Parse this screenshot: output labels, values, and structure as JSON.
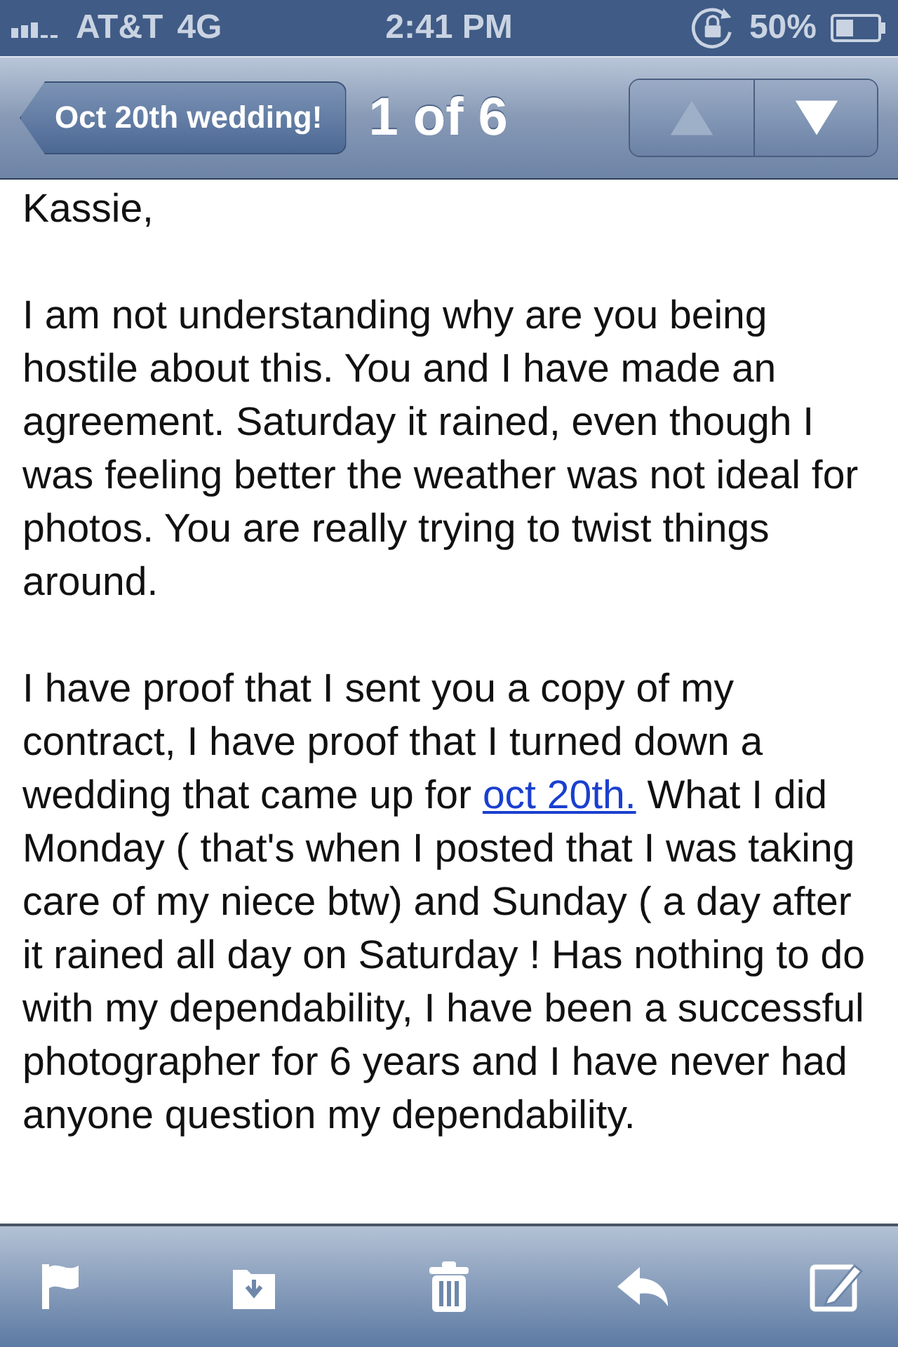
{
  "status_bar": {
    "carrier": "AT&T",
    "network": "4G",
    "time": "2:41 PM",
    "battery": "50%"
  },
  "nav_bar": {
    "back": "Oct 20th wedding!",
    "position": "1 of 6",
    "arrows": [
      {
        "kind": "up",
        "disabled": true
      },
      {
        "kind": "down",
        "disabled": false
      }
    ]
  },
  "message": {
    "greeting": "Kassie,",
    "paragraphs": [
      [
        {
          "text": "I am not understanding why are you being hostile about this. You and I have made an agreement. Saturday it rained, even though I was feeling better the weather was not ideal for photos. You are really trying to twist things around."
        }
      ],
      [
        {
          "text": "I have proof that I sent you a copy of my contract, I have proof that I turned down a wedding that came up for "
        },
        {
          "text": "oct 20th.",
          "kind": "link"
        },
        {
          "text": " What I did Monday ( that's when I posted that I was taking care of my niece btw) and Sunday ( a day after it rained all day on Saturday ! Has nothing to do with my dependability, I have been a successful photographer for 6 years and I have never had anyone question my dependability."
        }
      ]
    ]
  },
  "toolbar": {
    "buttons": [
      {
        "kind": "flag"
      },
      {
        "kind": "move"
      },
      {
        "kind": "trash"
      },
      {
        "kind": "reply"
      },
      {
        "kind": "compose"
      }
    ]
  }
}
